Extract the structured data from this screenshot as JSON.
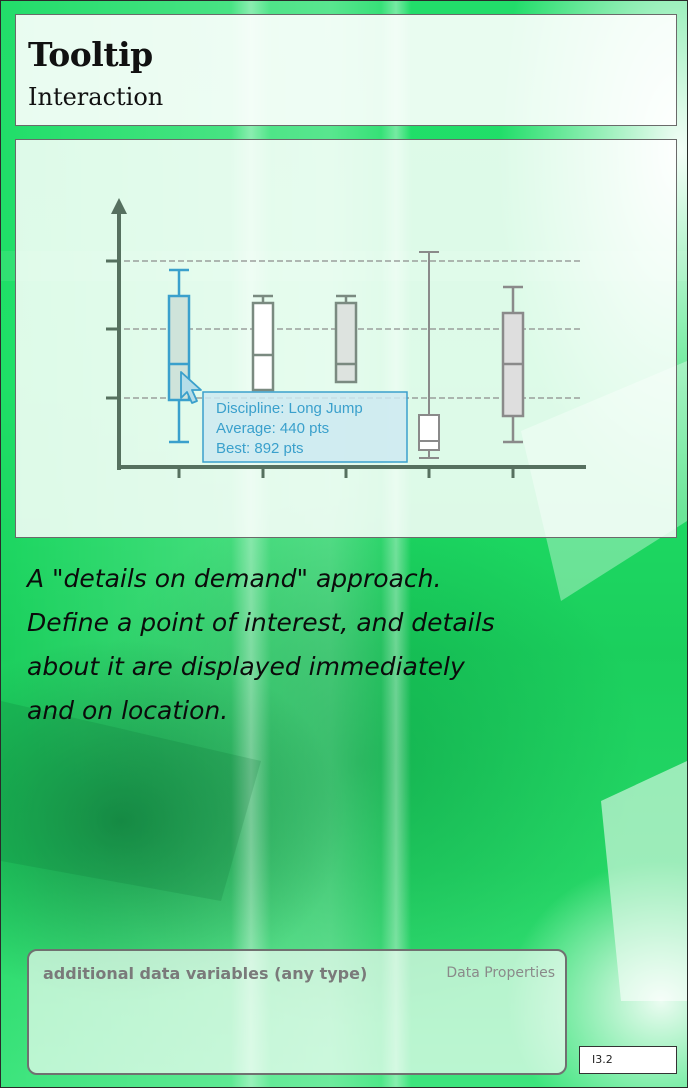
{
  "card": {
    "title": "Tooltip",
    "category": "Interaction",
    "description_lines": [
      "A \"details on demand\" approach.",
      "Define a point of interest, and details",
      "about it are displayed immediately",
      "and on location."
    ],
    "properties": {
      "header": "Data Properties",
      "label": "additional data variables (any type)"
    },
    "code": "I3.2"
  },
  "illustration": {
    "tooltip_lines": [
      "Discipline: Long Jump",
      "Average: 440 pts",
      "Best: 892 pts"
    ]
  },
  "colors": {
    "accent": "#3aa0cc",
    "background_green": "#1ee066",
    "box_gray": "#8a9a8f"
  }
}
